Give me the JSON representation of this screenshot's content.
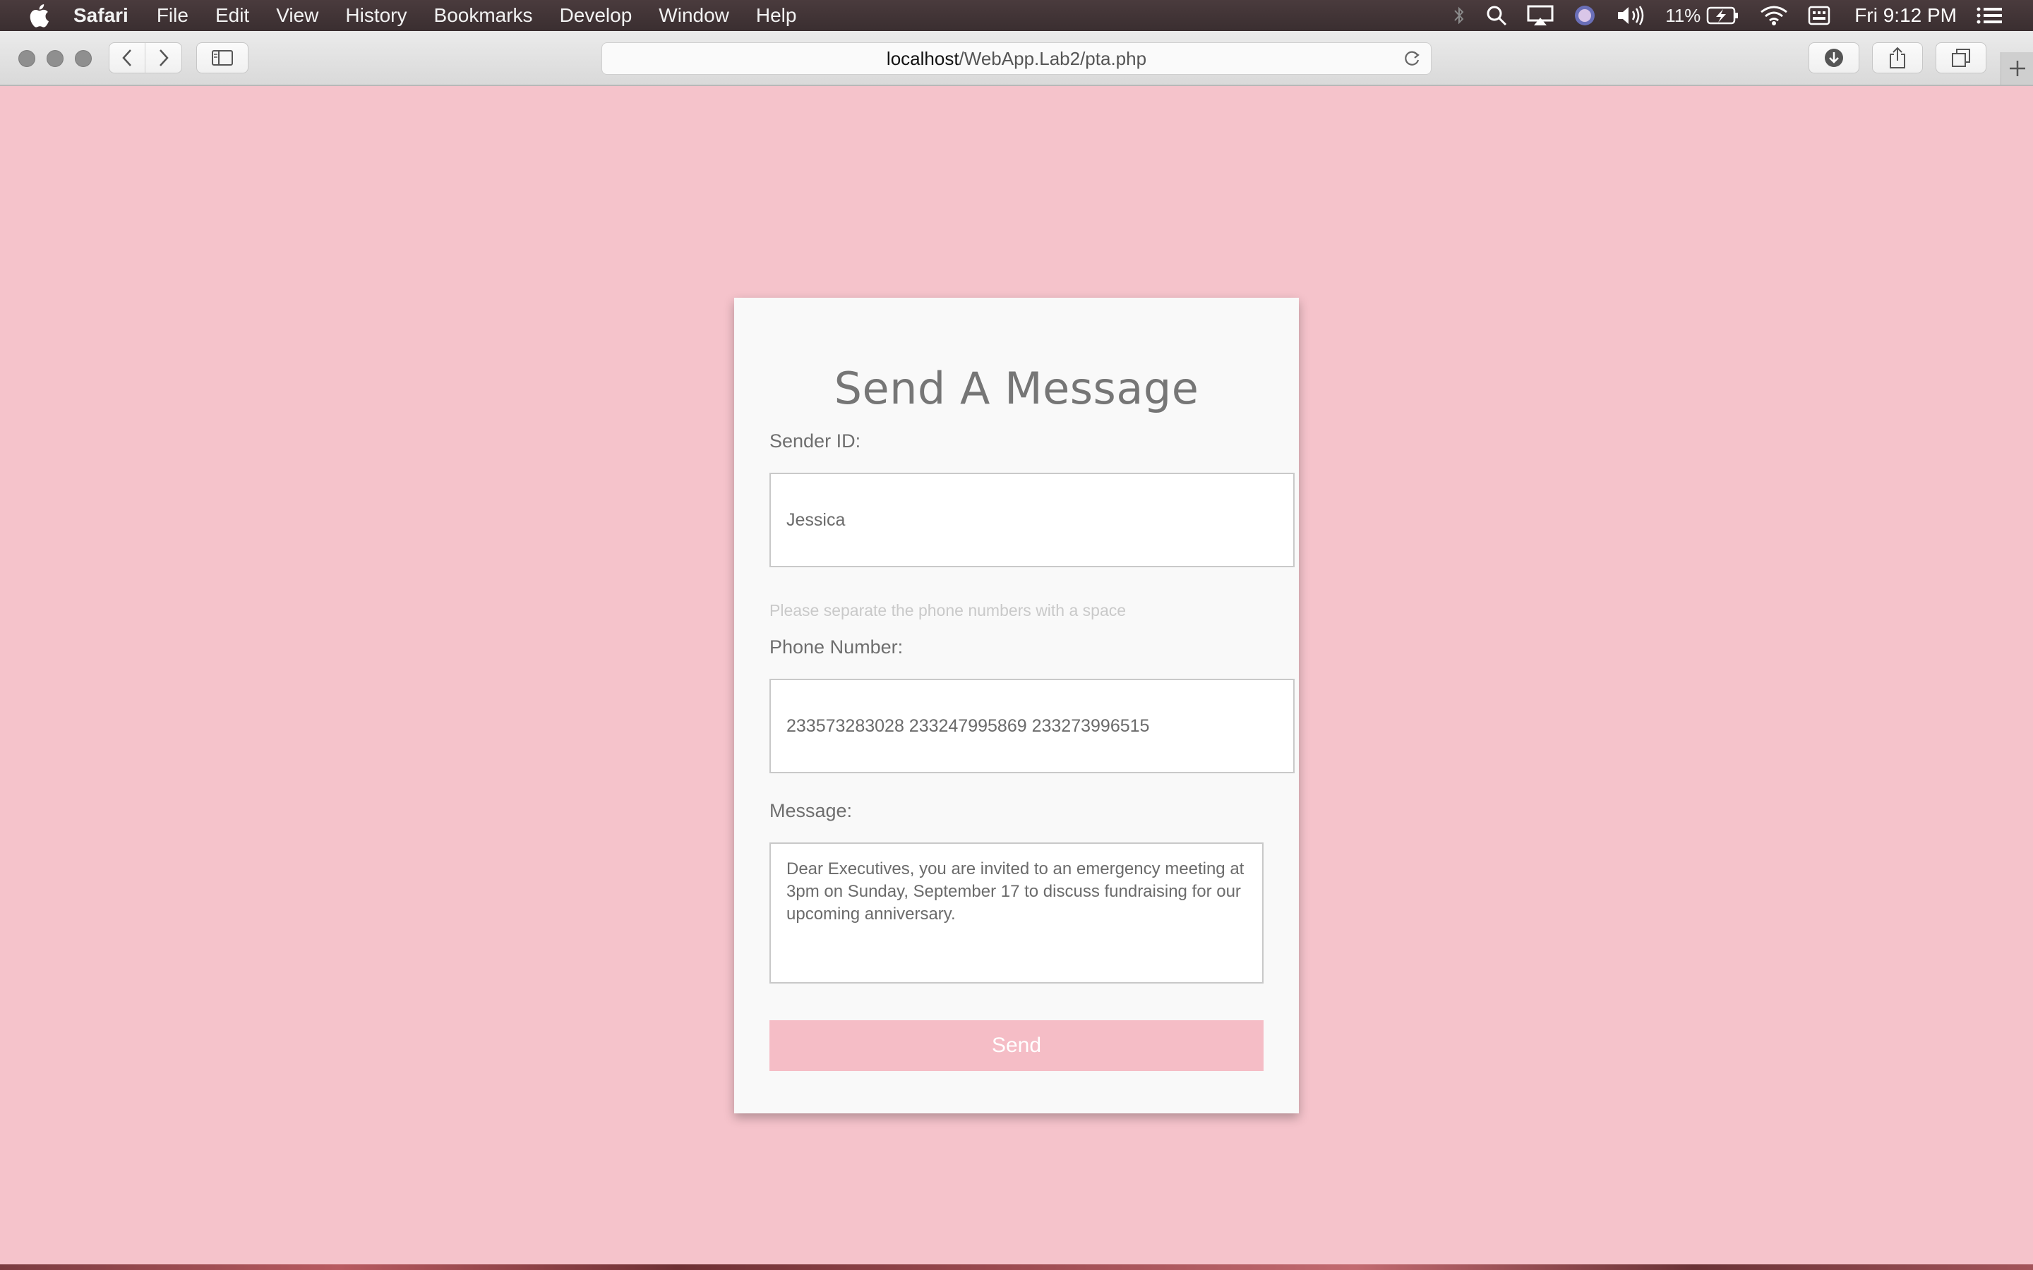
{
  "menubar": {
    "app": "Safari",
    "items": [
      "File",
      "Edit",
      "View",
      "History",
      "Bookmarks",
      "Develop",
      "Window",
      "Help"
    ],
    "battery": "11%",
    "clock": "Fri 9:12 PM"
  },
  "browser": {
    "url_host": "localhost",
    "url_path": "/WebApp.Lab2/pta.php"
  },
  "form": {
    "title": "Send A Message",
    "sender_label": "Sender ID:",
    "sender_value": "Jessica",
    "phone_hint": "Please separate the phone numbers with a space",
    "phone_label": "Phone Number:",
    "phone_value": "233573283028 233247995869 233273996515",
    "message_label": "Message:",
    "message_value": "Dear Executives, you are invited to an emergency meeting at 3pm on Sunday, September 17 to discuss fundraising for our upcoming anniversary.",
    "send_label": "Send"
  },
  "colors": {
    "page_background": "#f5c3cb",
    "send_button": "#f5bdc6"
  }
}
